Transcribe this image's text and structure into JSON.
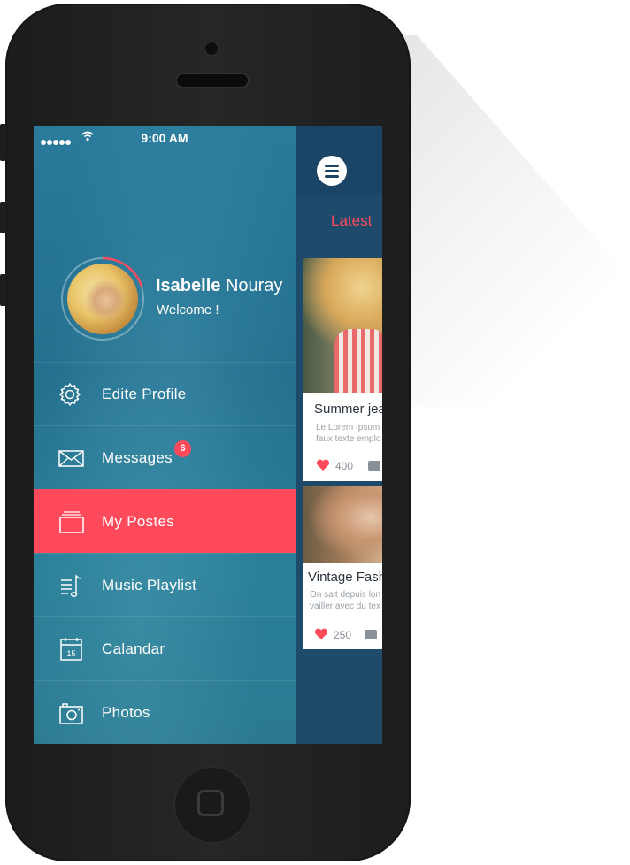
{
  "status_bar": {
    "time": "9:00 AM"
  },
  "profile": {
    "first_name": "Isabelle",
    "last_name": " Nouray",
    "greeting": "Welcome !"
  },
  "menu": {
    "items": [
      {
        "label": "Edite Profile",
        "icon": "gear-icon"
      },
      {
        "label": "Messages",
        "icon": "envelope-icon",
        "badge": "6"
      },
      {
        "label": "My Postes",
        "icon": "cards-icon",
        "active": true
      },
      {
        "label": "Music Playlist",
        "icon": "music-list-icon"
      },
      {
        "label": "Calandar",
        "icon": "calendar-icon",
        "day": "15"
      },
      {
        "label": "Photos",
        "icon": "camera-icon"
      }
    ]
  },
  "feed": {
    "tab_label": "Latest",
    "cards": [
      {
        "title": "Summer jea",
        "text_line1": "Le Lorem Ipsum",
        "text_line2": "faux texte emplo",
        "likes": "400"
      },
      {
        "title": "Vintage Fash",
        "text_line1": "On sait depuis lon",
        "text_line2": "vailler avec du tex",
        "likes": "250"
      }
    ]
  },
  "colors": {
    "accent": "#ff4a5c",
    "drawer_bg": "#2a7a9c",
    "feed_bg": "#1e4a6c",
    "phone_body": "#222223"
  }
}
